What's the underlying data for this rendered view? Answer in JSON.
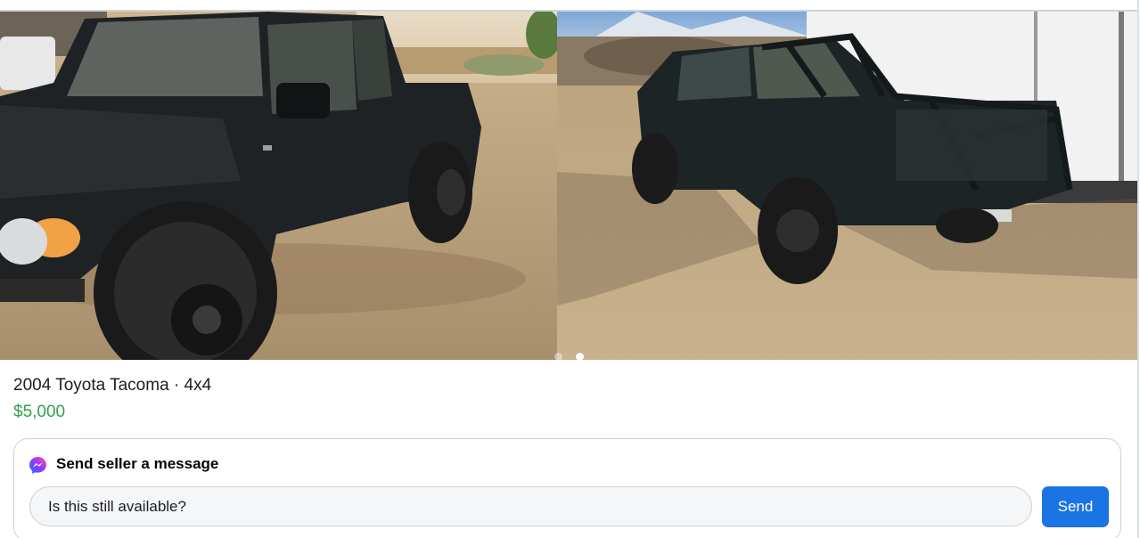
{
  "gallery": {
    "photos": [
      {
        "alt_icon": "truck-photo-front"
      },
      {
        "alt_icon": "truck-photo-rear"
      }
    ],
    "active_index": 1
  },
  "listing": {
    "title": "2004 Toyota Tacoma · 4x4",
    "price": "$5,000"
  },
  "message": {
    "heading": "Send seller a message",
    "input_value": "Is this still available?",
    "send_label": "Send"
  },
  "colors": {
    "price": "#31a24c",
    "send_button": "#1b74e4",
    "input_background": "#f5f6f8"
  }
}
